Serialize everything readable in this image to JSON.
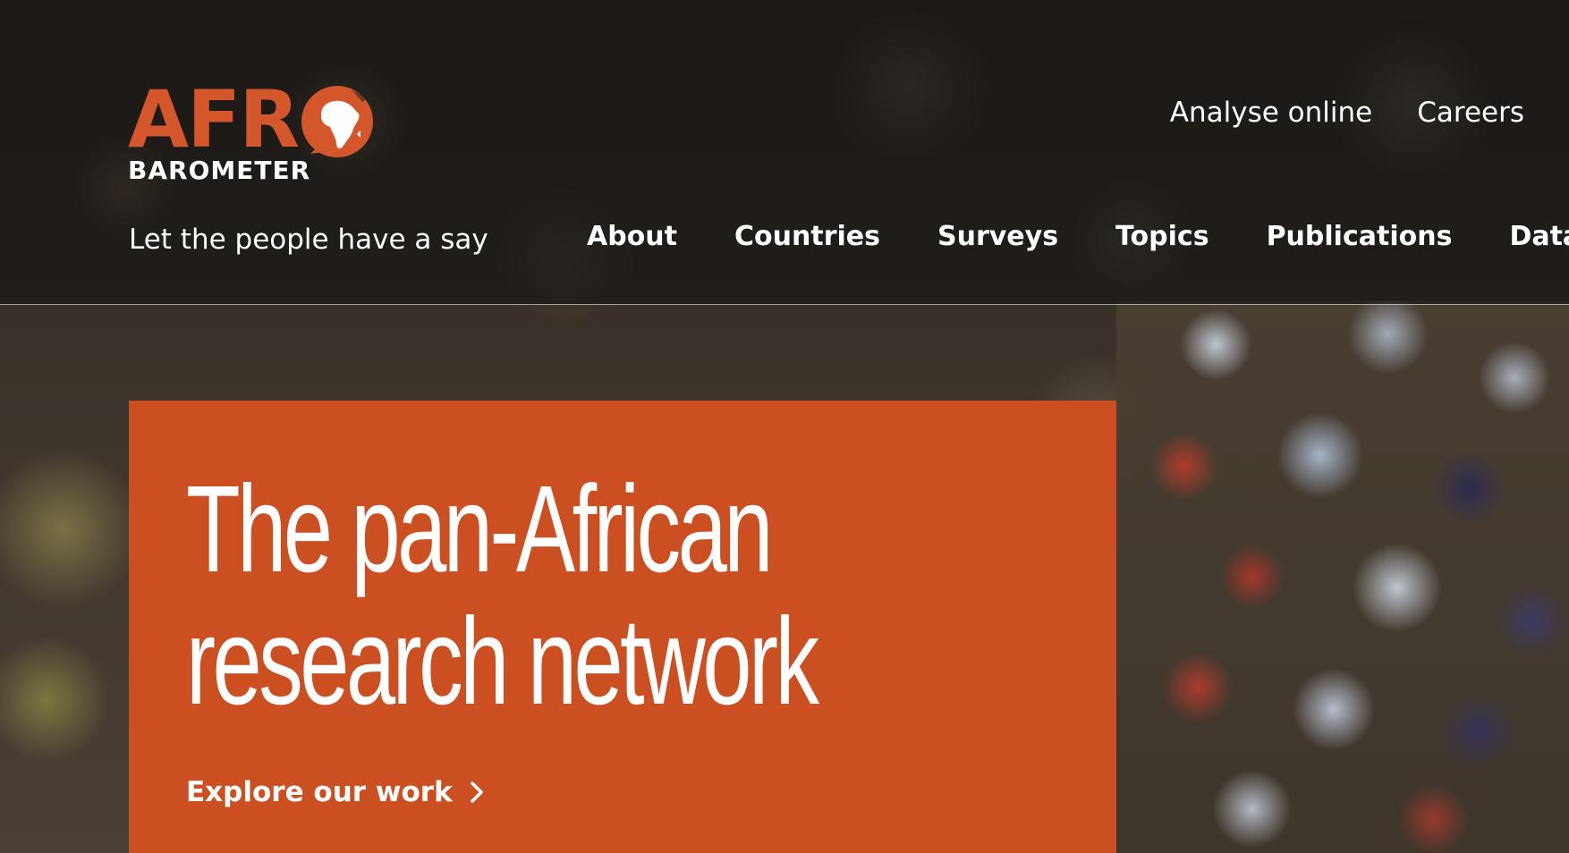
{
  "brand": {
    "logo_top": "AFR",
    "logo_bottom": "BAROMETER",
    "tagline": "Let the people have a say",
    "accent_color": "#cc4f22"
  },
  "utility_nav": [
    {
      "label": "Analyse online"
    },
    {
      "label": "Careers"
    }
  ],
  "main_nav": [
    {
      "label": "About"
    },
    {
      "label": "Countries"
    },
    {
      "label": "Surveys"
    },
    {
      "label": "Topics"
    },
    {
      "label": "Publications"
    },
    {
      "label": "Data"
    }
  ],
  "hero": {
    "title_line1": "The pan-African",
    "title_line2": "research network",
    "cta_label": "Explore our work",
    "cta_icon": "chevron-right-icon"
  }
}
